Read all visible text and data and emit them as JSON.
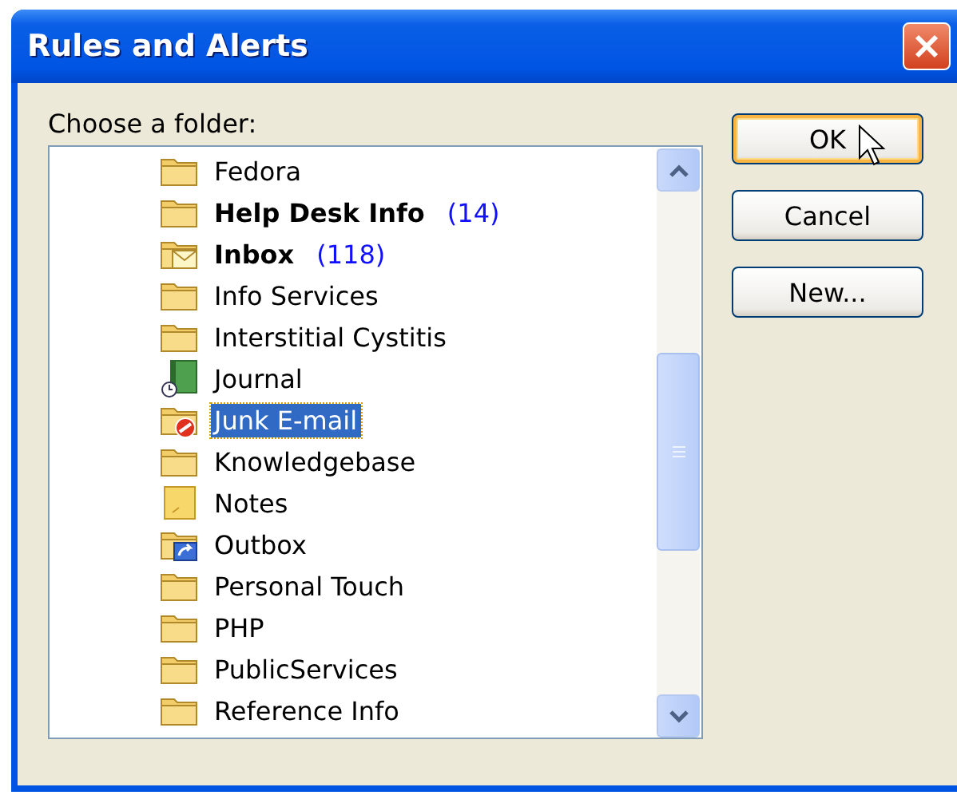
{
  "window": {
    "title": "Rules and Alerts"
  },
  "prompt": "Choose a folder:",
  "folders": [
    {
      "label": "Fedora",
      "kind": "folder",
      "bold": false,
      "selected": false
    },
    {
      "label": "Help Desk Info",
      "count": "(14)",
      "kind": "folder",
      "bold": true,
      "selected": false
    },
    {
      "label": "Inbox",
      "count": "(118)",
      "kind": "mail",
      "bold": true,
      "selected": false
    },
    {
      "label": "Info Services",
      "kind": "folder",
      "bold": false,
      "selected": false
    },
    {
      "label": "Interstitial Cystitis",
      "kind": "folder",
      "bold": false,
      "selected": false
    },
    {
      "label": "Journal",
      "kind": "journal",
      "bold": false,
      "selected": false
    },
    {
      "label": "Junk E-mail",
      "kind": "junk",
      "bold": false,
      "selected": true
    },
    {
      "label": "Knowledgebase",
      "kind": "folder",
      "bold": false,
      "selected": false
    },
    {
      "label": "Notes",
      "kind": "notes",
      "bold": false,
      "selected": false
    },
    {
      "label": "Outbox",
      "kind": "outbox",
      "bold": false,
      "selected": false
    },
    {
      "label": "Personal Touch",
      "kind": "folder",
      "bold": false,
      "selected": false
    },
    {
      "label": "PHP",
      "kind": "folder",
      "bold": false,
      "selected": false
    },
    {
      "label": "PublicServices",
      "kind": "folder",
      "bold": false,
      "selected": false
    },
    {
      "label": "Reference Info",
      "kind": "folder",
      "bold": false,
      "selected": false
    }
  ],
  "buttons": [
    {
      "label": "OK",
      "default": true
    },
    {
      "label": "Cancel",
      "default": false
    },
    {
      "label": "New...",
      "default": false
    }
  ]
}
